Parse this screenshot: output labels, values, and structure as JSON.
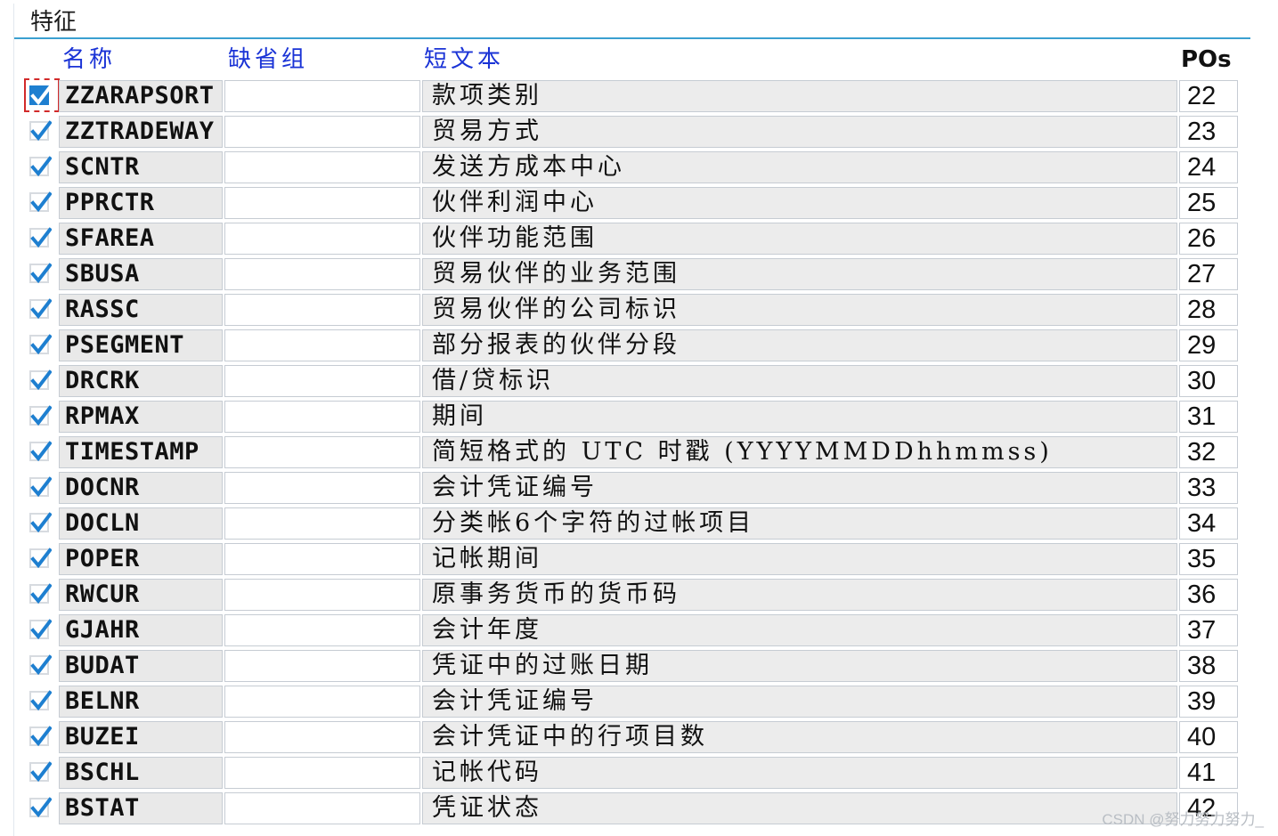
{
  "section": {
    "title": "特征"
  },
  "columns": {
    "name": "名称",
    "default_group": "缺省组",
    "short_text": "短文本",
    "pos": "POs"
  },
  "colors": {
    "header_text": "#1a33d6",
    "rule": "#3ba0d0",
    "checkbox_check": "#1e7fd0",
    "focus": "#d22a2a"
  },
  "rows": [
    {
      "checked": true,
      "focused": true,
      "name": "ZZARAPSORT",
      "group": "",
      "short_text": "款项类别",
      "pos": "22"
    },
    {
      "checked": true,
      "name": "ZZTRADEWAY",
      "group": "",
      "short_text": "贸易方式",
      "pos": "23"
    },
    {
      "checked": true,
      "name": "SCNTR",
      "group": "",
      "short_text": "发送方成本中心",
      "pos": "24"
    },
    {
      "checked": true,
      "name": "PPRCTR",
      "group": "",
      "short_text": "伙伴利润中心",
      "pos": "25"
    },
    {
      "checked": true,
      "name": "SFAREA",
      "group": "",
      "short_text": "伙伴功能范围",
      "pos": "26"
    },
    {
      "checked": true,
      "name": "SBUSA",
      "group": "",
      "short_text": "贸易伙伴的业务范围",
      "pos": "27"
    },
    {
      "checked": true,
      "name": "RASSC",
      "group": "",
      "short_text": "贸易伙伴的公司标识",
      "pos": "28"
    },
    {
      "checked": true,
      "name": "PSEGMENT",
      "group": "",
      "short_text": "部分报表的伙伴分段",
      "pos": "29"
    },
    {
      "checked": true,
      "name": "DRCRK",
      "group": "",
      "short_text": "借/贷标识",
      "pos": "30"
    },
    {
      "checked": true,
      "name": "RPMAX",
      "group": "",
      "short_text": "期间",
      "pos": "31"
    },
    {
      "checked": true,
      "name": "TIMESTAMP",
      "group": "",
      "short_text": "简短格式的 UTC 时戳 (YYYYMMDDhhmmss)",
      "pos": "32"
    },
    {
      "checked": true,
      "name": "DOCNR",
      "group": "",
      "short_text": "会计凭证编号",
      "pos": "33"
    },
    {
      "checked": true,
      "name": "DOCLN",
      "group": "",
      "short_text": "分类帐6个字符的过帐项目",
      "pos": "34"
    },
    {
      "checked": true,
      "name": "POPER",
      "group": "",
      "short_text": "记帐期间",
      "pos": "35"
    },
    {
      "checked": true,
      "name": "RWCUR",
      "group": "",
      "short_text": "原事务货币的货币码",
      "pos": "36"
    },
    {
      "checked": true,
      "name": "GJAHR",
      "group": "",
      "short_text": "会计年度",
      "pos": "37"
    },
    {
      "checked": true,
      "name": "BUDAT",
      "group": "",
      "short_text": "凭证中的过账日期",
      "pos": "38"
    },
    {
      "checked": true,
      "name": "BELNR",
      "group": "",
      "short_text": "会计凭证编号",
      "pos": "39"
    },
    {
      "checked": true,
      "name": "BUZEI",
      "group": "",
      "short_text": "会计凭证中的行项目数",
      "pos": "40"
    },
    {
      "checked": true,
      "name": "BSCHL",
      "group": "",
      "short_text": "记帐代码",
      "pos": "41"
    },
    {
      "checked": true,
      "name": "BSTAT",
      "group": "",
      "short_text": "凭证状态",
      "pos": "42"
    }
  ],
  "watermark": "CSDN @努力努力努力_"
}
